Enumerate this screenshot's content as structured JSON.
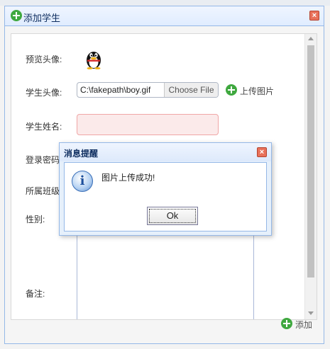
{
  "dialog": {
    "title": "添加学生",
    "close_glyph": "×",
    "add_button": "添加"
  },
  "form": {
    "preview_label": "预览头像:",
    "avatar_label": "学生头像:",
    "file_path": "C:\\fakepath\\boy.gif",
    "choose_file": "Choose File",
    "upload_link": "上传图片",
    "name_label": "学生姓名:",
    "name_value": "",
    "password_label": "登录密码",
    "class_label": "所属班级",
    "gender_label": "性别:",
    "remarks_label": "备注:"
  },
  "message": {
    "title": "消息提醒",
    "text": "图片上传成功!",
    "ok_label": "Ok",
    "close_glyph": "×",
    "icon_glyph": "i"
  },
  "colors": {
    "dialog_border": "#95b8e7",
    "header_bg": "#e0ecff",
    "name_input_bg": "#fbeaea",
    "name_input_border": "#f0a6a6",
    "close_button": "#e8715a",
    "add_icon": "#3fa83f"
  },
  "icons": {
    "dialog_icon": "plus-circle-icon",
    "upload_icon": "plus-circle-icon",
    "add_icon": "plus-circle-icon",
    "preview_image": "penguin-avatar",
    "message_icon": "info-icon"
  }
}
